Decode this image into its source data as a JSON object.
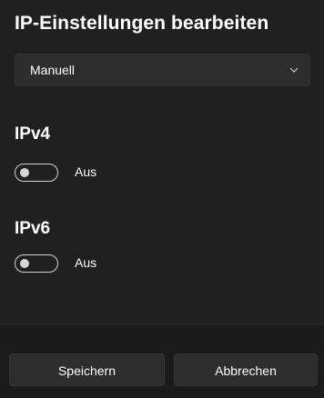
{
  "dialog": {
    "title": "IP-Einstellungen bearbeiten"
  },
  "mode_select": {
    "value": "Manuell",
    "icon": "chevron-down-icon"
  },
  "ipv4": {
    "heading": "IPv4",
    "toggle_on": false,
    "state_label": "Aus"
  },
  "ipv6": {
    "heading": "IPv6",
    "toggle_on": false,
    "state_label": "Aus"
  },
  "footer": {
    "save_label": "Speichern",
    "cancel_label": "Abbrechen"
  },
  "colors": {
    "background": "#202020",
    "control": "#2d2d2d",
    "text": "#ffffff"
  }
}
